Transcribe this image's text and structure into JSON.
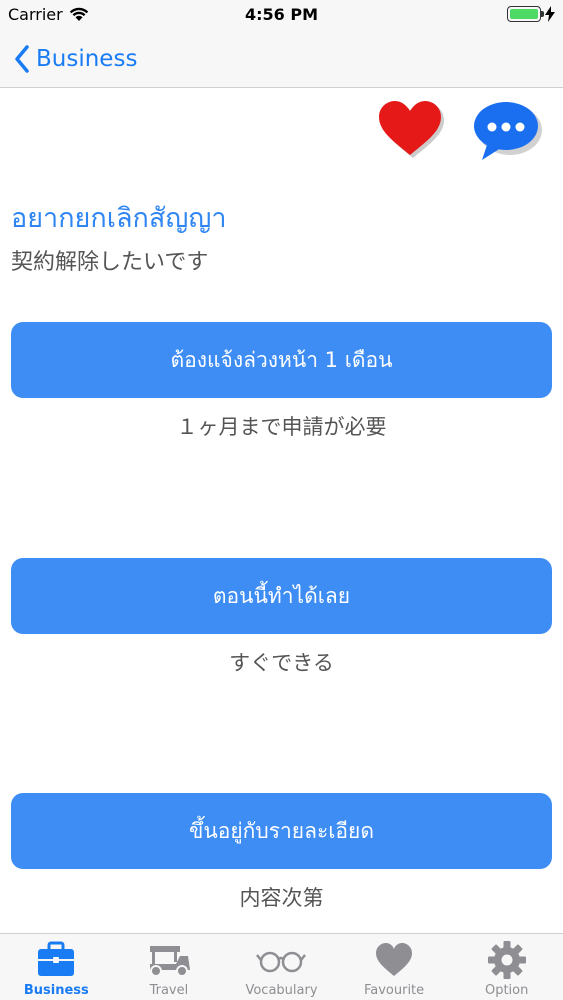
{
  "status_bar": {
    "carrier": "Carrier",
    "time": "4:56 PM"
  },
  "nav": {
    "back_label": "Business"
  },
  "actions": {
    "favorite_icon": "heart-icon",
    "comment_icon": "chat-bubble-icon"
  },
  "phrase": {
    "thai": "อยากยกเลิกสัญญา",
    "japanese": "契約解除したいです"
  },
  "answers": [
    {
      "thai": "ต้องแจ้งล่วงหน้า 1 เดือน",
      "japanese": "１ヶ月まで申請が必要"
    },
    {
      "thai": "ตอนนี้ทำได้เลย",
      "japanese": "すぐできる"
    },
    {
      "thai": "ขึ้นอยู่กับรายละเอียด",
      "japanese": "内容次第"
    }
  ],
  "tabs": [
    {
      "label": "Business",
      "icon": "briefcase-icon",
      "active": true
    },
    {
      "label": "Travel",
      "icon": "tuk-tuk-icon",
      "active": false
    },
    {
      "label": "Vocabulary",
      "icon": "glasses-icon",
      "active": false
    },
    {
      "label": "Favourite",
      "icon": "heart-icon",
      "active": false
    },
    {
      "label": "Option",
      "icon": "gear-icon",
      "active": false
    }
  ],
  "colors": {
    "accent": "#1a7cf4",
    "button": "#3d8df5",
    "heart": "#e61919",
    "inactive_tab": "#8e8e93"
  }
}
